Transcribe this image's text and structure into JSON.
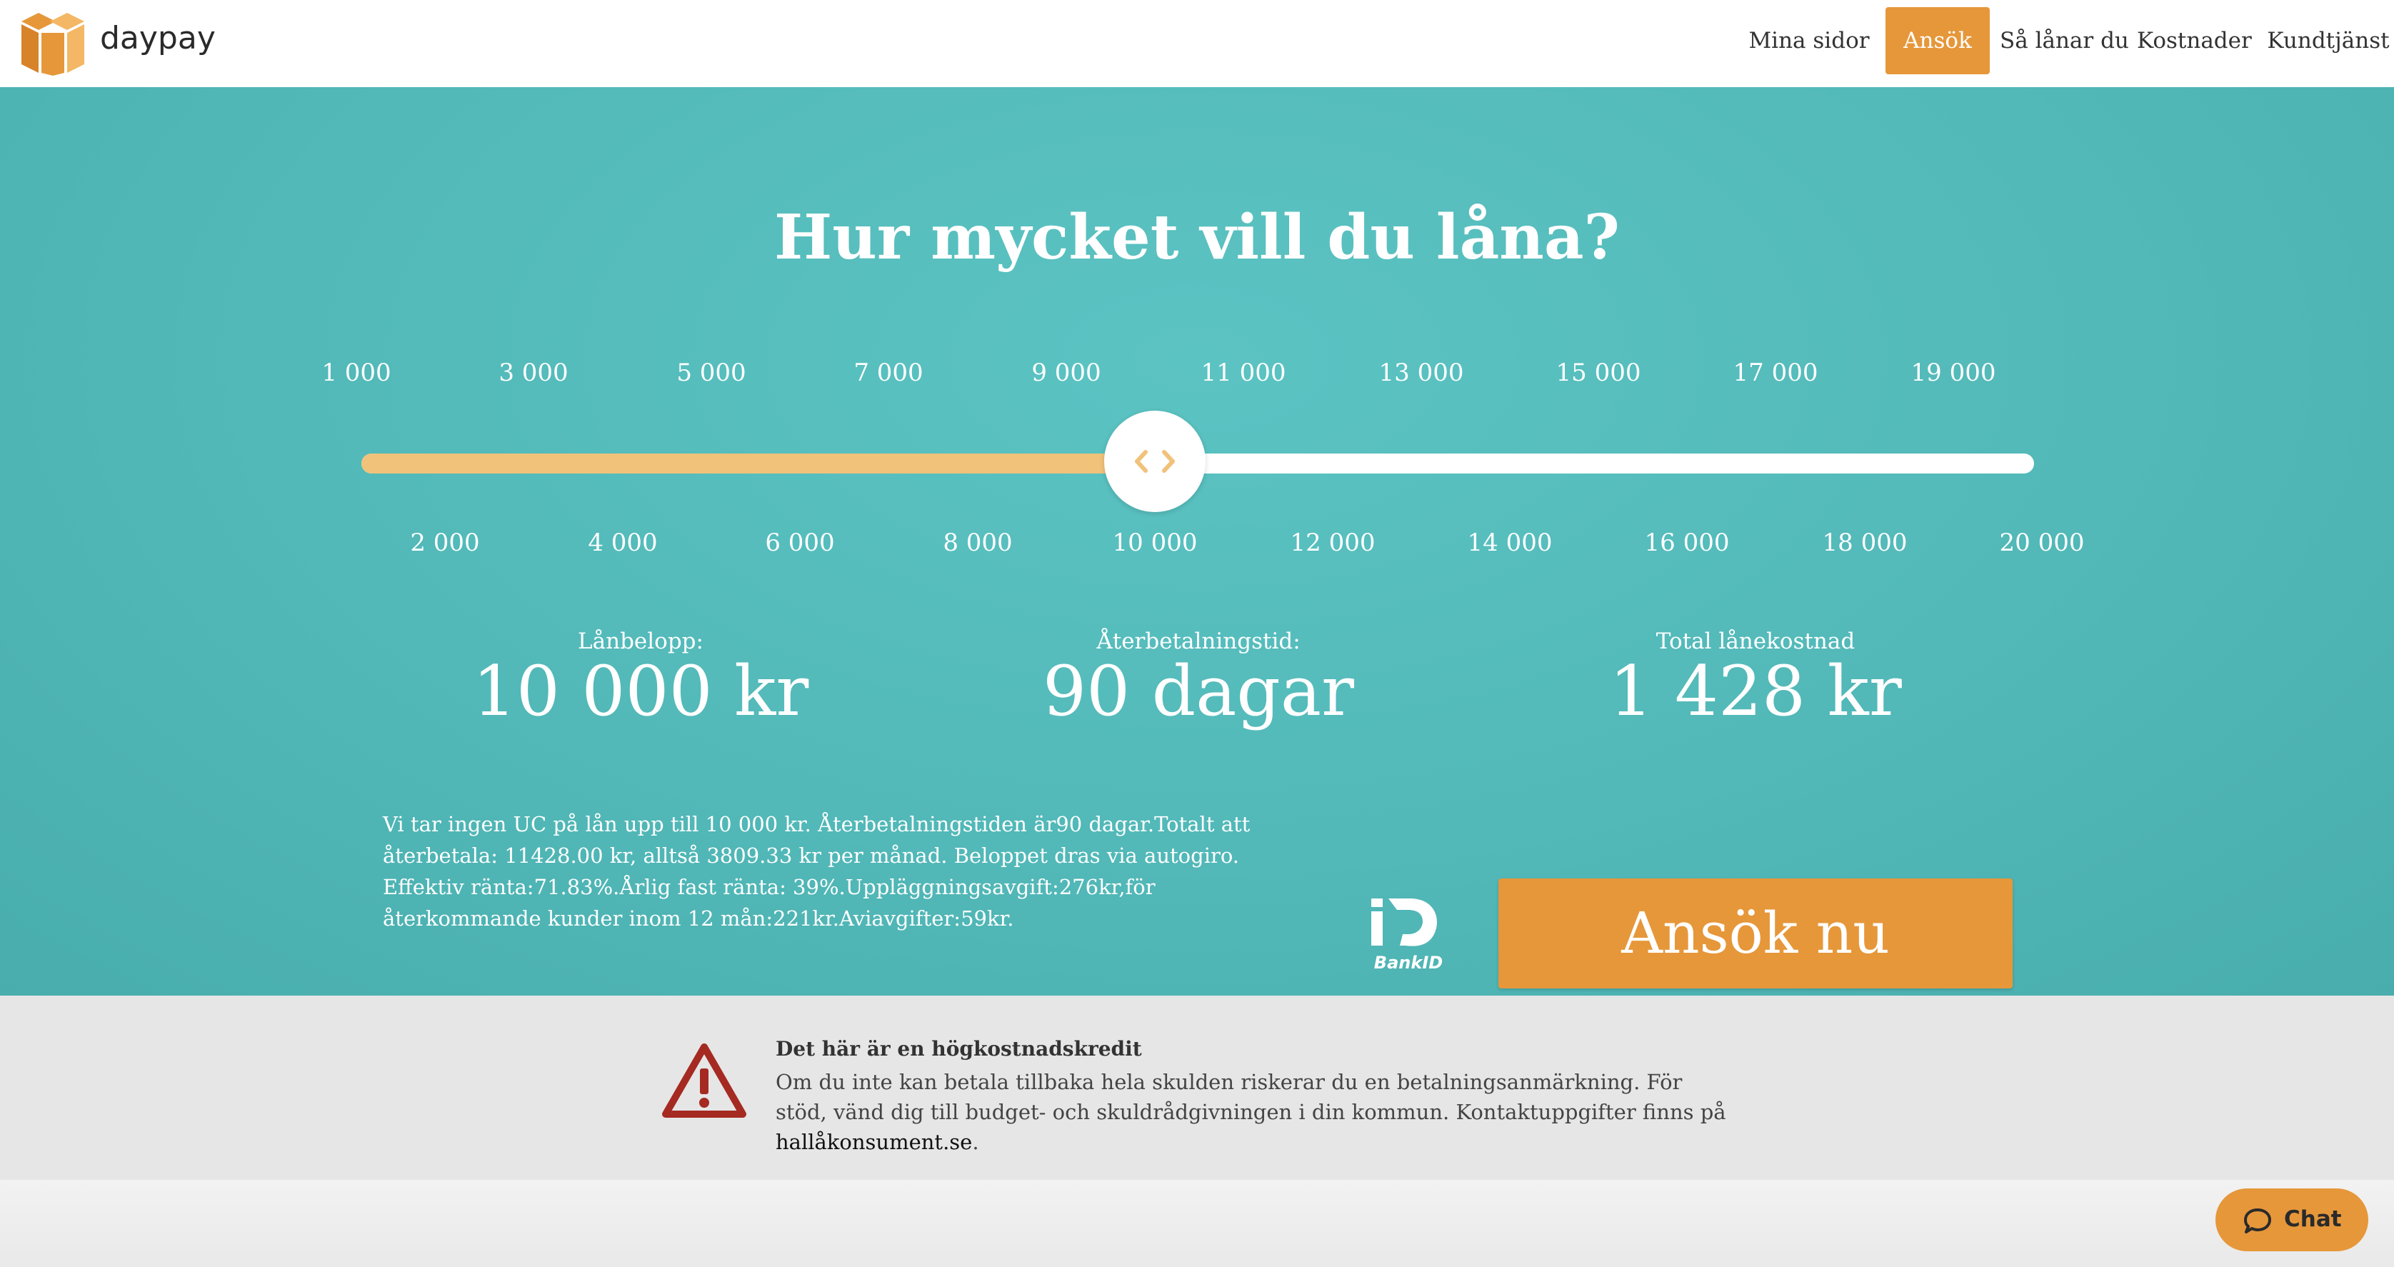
{
  "brand": {
    "name": "daypay"
  },
  "nav": [
    {
      "id": "mina-sidor",
      "label": "Mina sidor",
      "active": false
    },
    {
      "id": "ansok",
      "label": "Ansök",
      "active": true
    },
    {
      "id": "sa-lanar-du",
      "label": "Så lånar du",
      "active": false
    },
    {
      "id": "kostnader",
      "label": "Kostnader",
      "active": false
    },
    {
      "id": "kundtjanst",
      "label": "Kundtjänst",
      "active": false
    }
  ],
  "hero": {
    "title": "Hur mycket vill du låna?"
  },
  "slider": {
    "top_ticks": [
      "1 000",
      "3 000",
      "5 000",
      "7 000",
      "9 000",
      "11 000",
      "13 000",
      "15 000",
      "17 000",
      "19 000"
    ],
    "bottom_ticks": [
      "2 000",
      "4 000",
      "6 000",
      "8 000",
      "10 000",
      "12 000",
      "14 000",
      "16 000",
      "18 000",
      "20 000"
    ],
    "value": 10000,
    "min": 1000,
    "max": 20000
  },
  "stats": {
    "loan_label": "Lånbelopp:",
    "loan_value": "10 000 kr",
    "term_label": "Återbetalningstid:",
    "term_value": "90 dagar",
    "cost_label": "Total lånekostnad",
    "cost_value": "1 428 kr"
  },
  "terms_text": "Vi tar ingen UC på lån upp till 10 000 kr. Återbetalningstiden är90 dagar.Totalt att återbetala: 11428.00 kr, alltså 3809.33 kr per månad. Beloppet dras via autogiro. Effektiv ränta:71.83%.Årlig fast ränta: 39%.Uppläggningsavgift:276kr,för återkommande kunder inom 12 mån:221kr.Aviavgifter:59kr.",
  "bankid_label": "BankID",
  "apply_button": "Ansök nu",
  "warning": {
    "title": "Det här är en högkostnadskredit",
    "text": "Om du inte kan betala tillbaka hela skulden riskerar du en betalningsanmärkning. För stöd, vänd dig till budget- och skuldrådgivningen i din kommun. Kontaktuppgifter finns på ",
    "link": "hallåkonsument.se",
    "text_end": "."
  },
  "chat": {
    "label": "Chat"
  },
  "colors": {
    "accent": "#e6973a",
    "teal": "#52b8b8",
    "slider_fill": "#f0c27a",
    "warning_red": "#a52a22"
  }
}
